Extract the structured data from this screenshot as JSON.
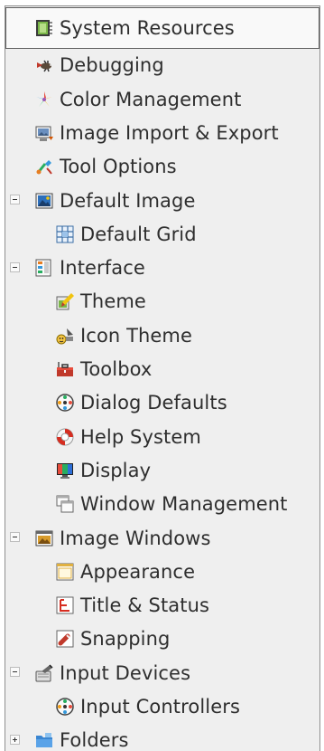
{
  "tree": {
    "items": [
      {
        "label": "System Resources",
        "icon": "system-resources-icon",
        "level": 0,
        "selected": true
      },
      {
        "label": "Debugging",
        "icon": "debugging-bug-icon",
        "level": 0
      },
      {
        "label": "Color Management",
        "icon": "color-management-icon",
        "level": 0
      },
      {
        "label": "Image Import & Export",
        "icon": "image-import-export-icon",
        "level": 0
      },
      {
        "label": "Tool Options",
        "icon": "tool-options-icon",
        "level": 0
      },
      {
        "label": "Default Image",
        "icon": "default-image-icon",
        "level": 0,
        "expander": "expanded"
      },
      {
        "label": "Default Grid",
        "icon": "grid-icon",
        "level": 1
      },
      {
        "label": "Interface",
        "icon": "interface-icon",
        "level": 0,
        "expander": "expanded"
      },
      {
        "label": "Theme",
        "icon": "theme-icon",
        "level": 1
      },
      {
        "label": "Icon Theme",
        "icon": "icon-theme-icon",
        "level": 1
      },
      {
        "label": "Toolbox",
        "icon": "toolbox-icon",
        "level": 1
      },
      {
        "label": "Dialog Defaults",
        "icon": "dialog-defaults-icon",
        "level": 1
      },
      {
        "label": "Help System",
        "icon": "help-lifebuoy-icon",
        "level": 1
      },
      {
        "label": "Display",
        "icon": "display-monitor-icon",
        "level": 1
      },
      {
        "label": "Window Management",
        "icon": "window-management-icon",
        "level": 1
      },
      {
        "label": "Image Windows",
        "icon": "image-windows-icon",
        "level": 0,
        "expander": "expanded"
      },
      {
        "label": "Appearance",
        "icon": "appearance-icon",
        "level": 1
      },
      {
        "label": "Title & Status",
        "icon": "title-status-icon",
        "level": 1
      },
      {
        "label": "Snapping",
        "icon": "snapping-icon",
        "level": 1
      },
      {
        "label": "Input Devices",
        "icon": "input-devices-icon",
        "level": 0,
        "expander": "expanded"
      },
      {
        "label": "Input Controllers",
        "icon": "input-controllers-icon",
        "level": 1
      },
      {
        "label": "Folders",
        "icon": "folders-icon",
        "level": 0,
        "expander": "collapsed"
      }
    ]
  }
}
